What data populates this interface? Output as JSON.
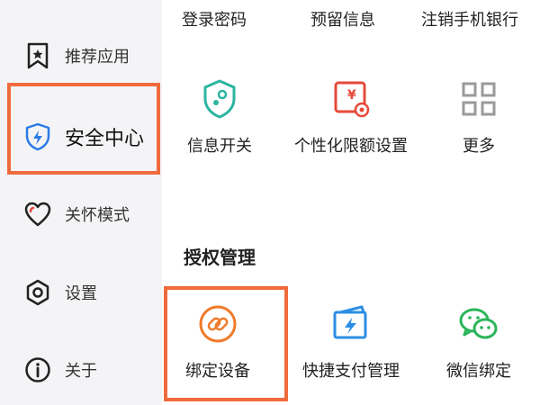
{
  "sidebar": {
    "items": [
      {
        "label": "推荐应用",
        "icon": "bookmark-star-icon"
      },
      {
        "label": "安全中心",
        "icon": "shield-lightning-icon",
        "active": true
      },
      {
        "label": "关怀模式",
        "icon": "heart-icon"
      },
      {
        "label": "设置",
        "icon": "gear-icon"
      },
      {
        "label": "关于",
        "icon": "info-icon"
      }
    ]
  },
  "top_row": {
    "labels": [
      "登录密码",
      "预留信息",
      "注销手机银行"
    ]
  },
  "security_tiles": [
    {
      "label": "信息开关",
      "icon": "info-switch-shield-icon",
      "color": "#2bb5a0"
    },
    {
      "label": "个性化限额设置",
      "icon": "limit-setting-icon",
      "color": "#e64a3b"
    },
    {
      "label": "更多",
      "icon": "grid-more-icon",
      "color": "#9a9a9a"
    }
  ],
  "authorization": {
    "title": "授权管理",
    "tiles": [
      {
        "label": "绑定设备",
        "icon": "link-icon",
        "color": "#f07a2a"
      },
      {
        "label": "快捷支付管理",
        "icon": "quick-pay-card-icon",
        "color": "#2b8ee6"
      },
      {
        "label": "微信绑定",
        "icon": "wechat-icon",
        "color": "#2bb55a"
      }
    ]
  },
  "colors": {
    "highlight": "#f06b3c",
    "sidebar_bg": "#f4f4f6",
    "active_icon": "#2b7be6"
  }
}
